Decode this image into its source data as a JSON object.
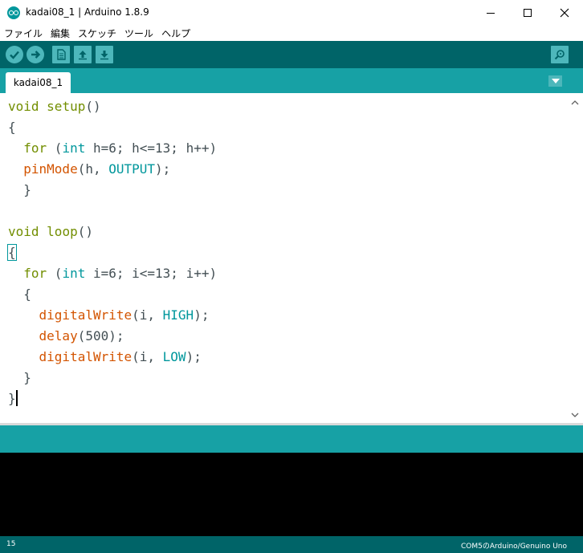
{
  "window": {
    "title": "kadai08_1 | Arduino 1.8.9"
  },
  "menu": [
    "ファイル",
    "編集",
    "スケッチ",
    "ツール",
    "ヘルプ"
  ],
  "toolbar": {
    "buttons": [
      "verify-icon",
      "upload-icon",
      "new-icon",
      "open-icon",
      "save-icon",
      "serial-monitor-icon"
    ]
  },
  "tabs": [
    {
      "label": "kadai08_1"
    }
  ],
  "editor": {
    "lines": [
      [
        {
          "t": "void",
          "c": "kw"
        },
        {
          "t": " "
        },
        {
          "t": "setup",
          "c": "kw"
        },
        {
          "t": "()"
        }
      ],
      [
        {
          "t": "{"
        }
      ],
      [
        {
          "t": "  "
        },
        {
          "t": "for",
          "c": "kw"
        },
        {
          "t": " ("
        },
        {
          "t": "int",
          "c": "ty"
        },
        {
          "t": " h=6; h<=13; h++)"
        }
      ],
      [
        {
          "t": "  "
        },
        {
          "t": "pinMode",
          "c": "fn"
        },
        {
          "t": "(h, "
        },
        {
          "t": "OUTPUT",
          "c": "ct"
        },
        {
          "t": ");"
        }
      ],
      [
        {
          "t": "  }"
        }
      ],
      [
        {
          "t": ""
        }
      ],
      [
        {
          "t": "void",
          "c": "kw"
        },
        {
          "t": " "
        },
        {
          "t": "loop",
          "c": "kw"
        },
        {
          "t": "()"
        }
      ],
      [
        {
          "t": "{",
          "c": "brace-hl"
        }
      ],
      [
        {
          "t": "  "
        },
        {
          "t": "for",
          "c": "kw"
        },
        {
          "t": " ("
        },
        {
          "t": "int",
          "c": "ty"
        },
        {
          "t": " i=6; i<=13; i++)"
        }
      ],
      [
        {
          "t": "  {"
        }
      ],
      [
        {
          "t": "    "
        },
        {
          "t": "digitalWrite",
          "c": "fn"
        },
        {
          "t": "(i, "
        },
        {
          "t": "HIGH",
          "c": "ct"
        },
        {
          "t": ");"
        }
      ],
      [
        {
          "t": "    "
        },
        {
          "t": "delay",
          "c": "fn"
        },
        {
          "t": "(500);"
        }
      ],
      [
        {
          "t": "    "
        },
        {
          "t": "digitalWrite",
          "c": "fn"
        },
        {
          "t": "(i, "
        },
        {
          "t": "LOW",
          "c": "ct"
        },
        {
          "t": ");"
        }
      ],
      [
        {
          "t": "  }"
        }
      ],
      [
        {
          "t": "}"
        },
        {
          "caret": true
        }
      ]
    ]
  },
  "footer": {
    "line_number": "15",
    "board": "COM5のArduino/Genuino Uno"
  }
}
